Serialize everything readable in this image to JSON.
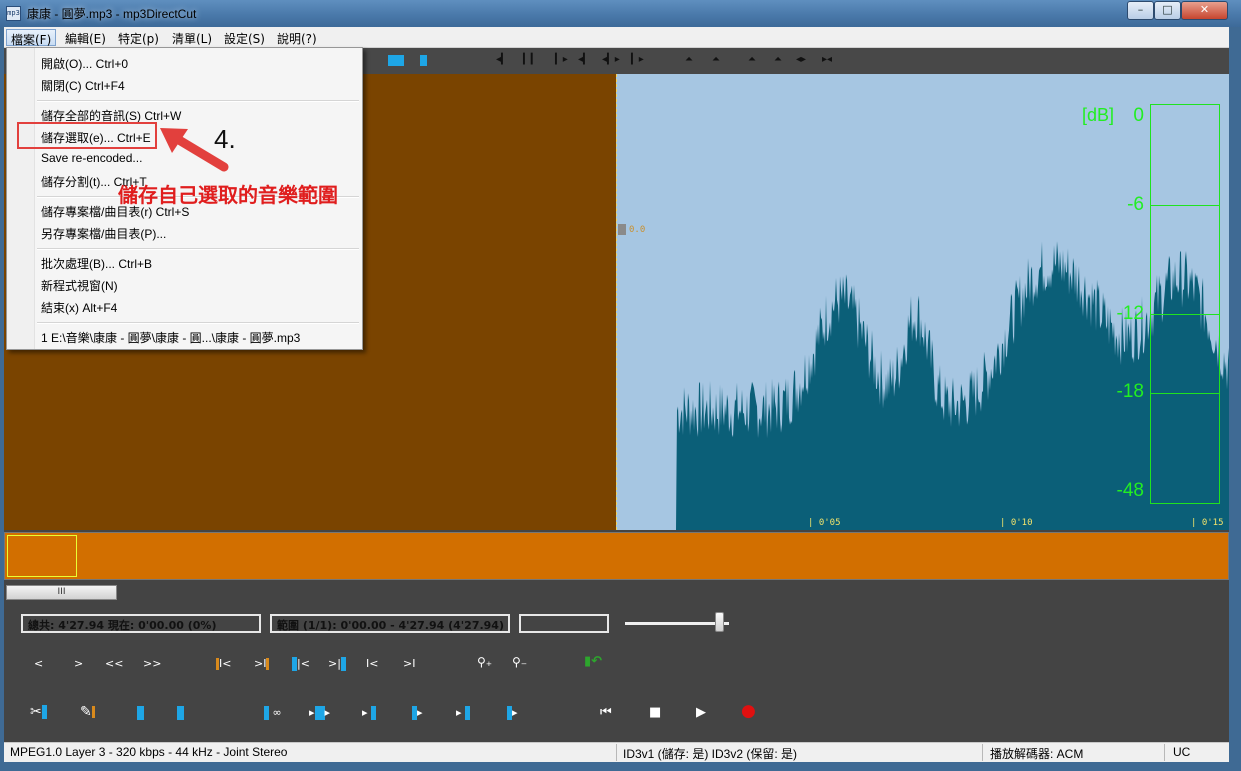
{
  "window": {
    "icon_text": "mp3",
    "title": "康康 - 圓夢.mp3 - mp3DirectCut",
    "buttons": {
      "minimize": "–",
      "maximize": "□",
      "close": "✕"
    }
  },
  "menubar": {
    "items": [
      {
        "label": "檔案(F)"
      },
      {
        "label": "編輯(E)"
      },
      {
        "label": "特定(p)"
      },
      {
        "label": "清單(L)"
      },
      {
        "label": "設定(S)"
      },
      {
        "label": "說明(?)"
      }
    ]
  },
  "file_menu": {
    "items": [
      {
        "label": "開啟(O)... Ctrl+0"
      },
      {
        "label": "關閉(C)    Ctrl+F4"
      },
      {
        "label": "儲存全部的音訊(S)    Ctrl+W"
      },
      {
        "label": "儲存選取(e)... Ctrl+E"
      },
      {
        "label": "Save re-encoded..."
      },
      {
        "label": "儲存分割(t)... Ctrl+T"
      },
      {
        "label": "儲存專案檔/曲目表(r)    Ctrl+S"
      },
      {
        "label": "另存專案檔/曲目表(P)..."
      },
      {
        "label": "批次處理(B)... Ctrl+B"
      },
      {
        "label": "新程式視窗(N)"
      },
      {
        "label": "結束(x)    Alt+F4"
      },
      {
        "label": "1 E:\\音樂\\康康 - 圓夢\\康康 - 圓...\\康康 - 圓夢.mp3"
      }
    ]
  },
  "annotation": {
    "step_number": "4.",
    "note": "儲存自己選取的音樂範圍",
    "color": "#e2403d"
  },
  "waveform": {
    "cursor_label": "0.0",
    "time_ticks": [
      "0'05",
      "0'10",
      "0'15"
    ],
    "colors": {
      "before_cursor": "#7a4400",
      "background": "#a6c6e2",
      "wave": "#0b5f78"
    }
  },
  "level_meter": {
    "unit": "[dB]",
    "labels": [
      "0",
      "-6",
      "-12",
      "-18",
      "-48"
    ],
    "color": "#1fe31f"
  },
  "overview": {
    "scroll_thumb": "III"
  },
  "info": {
    "total": "總共: 4'27.94  現在: 0'00.00  (0%)",
    "range": "範圍 (1/1): 0'00.00 - 4'27.94 (4'27.94)",
    "blank": ""
  },
  "volume": {
    "level": 0.9
  },
  "controls_row1": [
    "<",
    ">",
    "<<",
    ">>",
    "I<",
    ">I",
    "|<",
    ">|",
    "I<",
    ">I"
  ],
  "controls_row2": {
    "loop_label": "∞",
    "transport": {
      "prev": "⏮",
      "stop": "■",
      "play": "▶",
      "record": "●"
    }
  },
  "statusbar": {
    "format": "MPEG1.0 Layer 3 - 320 kbps - 44 kHz - Joint Stereo",
    "id3": "ID3v1 (儲存: 是)   ID3v2 (保留: 是)",
    "decoder": "播放解碼器: ACM",
    "mode": "UC"
  }
}
